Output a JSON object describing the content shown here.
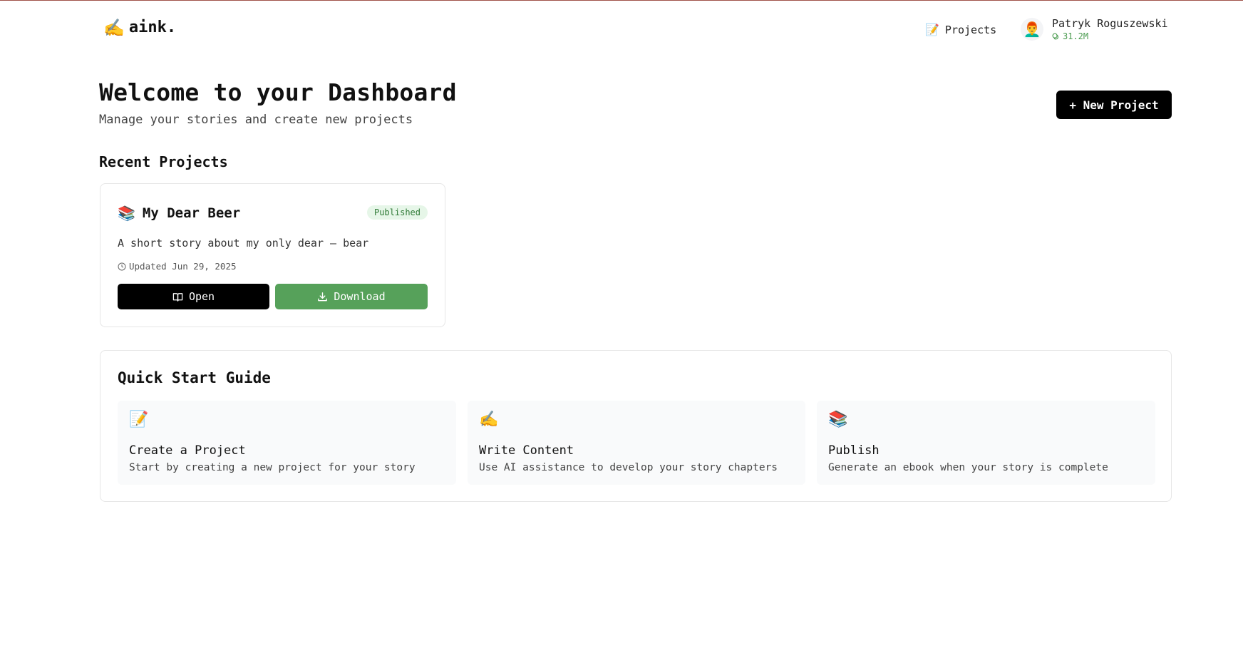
{
  "header": {
    "logo_glyph": "✍️",
    "logo_text": "aink.",
    "nav_projects_glyph": "📝",
    "nav_projects_label": "Projects",
    "user_avatar": "👨‍🦰",
    "user_name": "Patryk Roguszewski",
    "user_credits": "31.2M"
  },
  "hero": {
    "title": "Welcome to your Dashboard",
    "subtitle": "Manage your stories and create new projects",
    "new_project_label": "+ New Project"
  },
  "recent": {
    "title": "Recent Projects",
    "projects": [
      {
        "glyph": "📚",
        "title": "My Dear Beer",
        "status": "Published",
        "description": "A short story about my only dear – bear",
        "updated": "Updated Jun 29, 2025",
        "open_label": "Open",
        "download_label": "Download"
      }
    ]
  },
  "guide": {
    "title": "Quick Start Guide",
    "steps": [
      {
        "glyph": "📝",
        "title": "Create a Project",
        "description": "Start by creating a new project for your story"
      },
      {
        "glyph": "✍️",
        "title": "Write Content",
        "description": "Use AI assistance to develop your story chapters"
      },
      {
        "glyph": "📚",
        "title": "Publish",
        "description": "Generate an ebook when your story is complete"
      }
    ]
  },
  "colors": {
    "primary": "#000000",
    "download": "#56a15a",
    "badge_bg": "#e6f6e8",
    "badge_text": "#2f7a36",
    "credits": "#4a9b4f"
  }
}
